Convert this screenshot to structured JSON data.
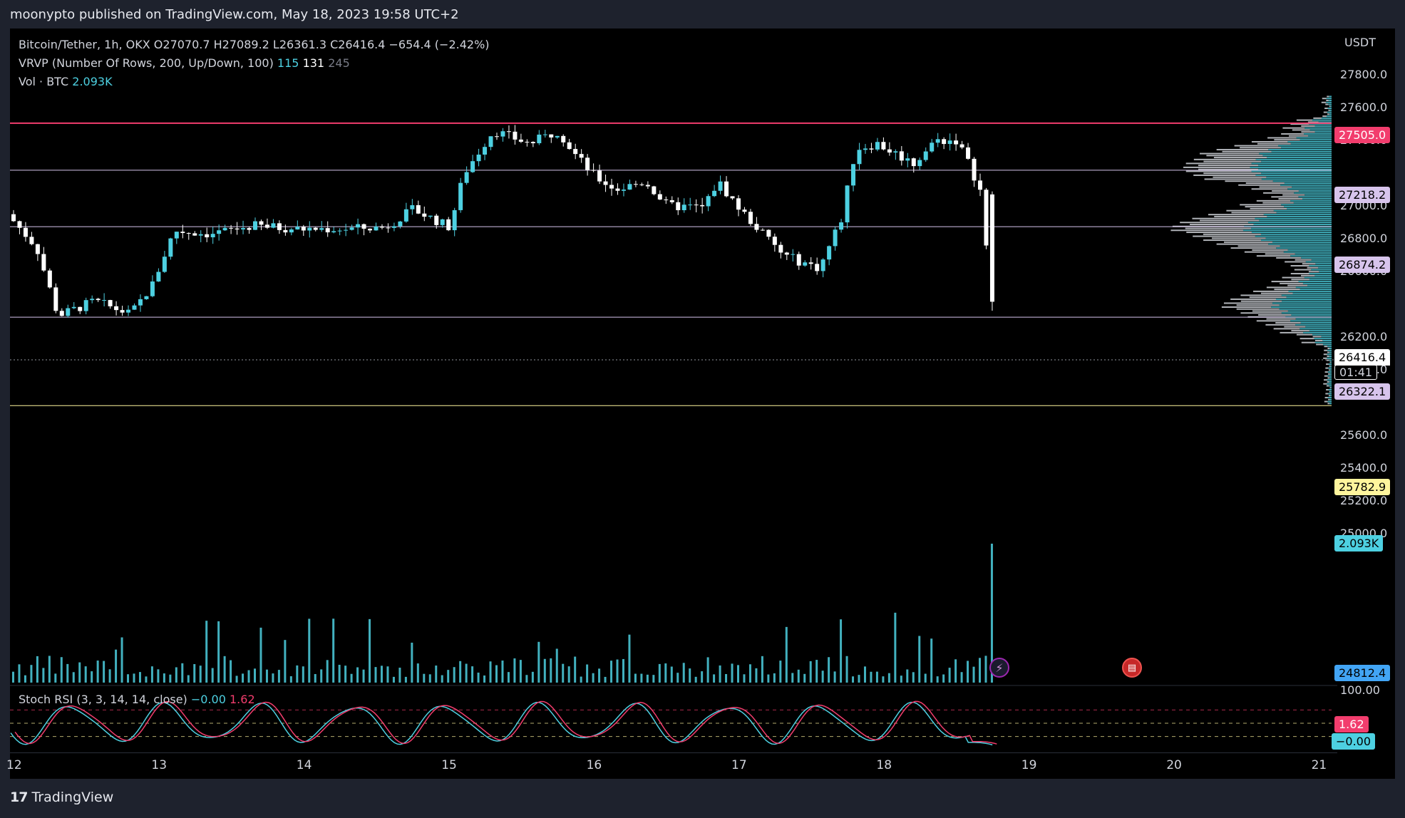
{
  "header": {
    "publish_text": "moonypto published on TradingView.com, May 18, 2023 19:58 UTC+2"
  },
  "legend": {
    "line1": "Bitcoin/Tether, 1h, OKX  O27070.7  H27089.2  L26361.3  C26416.4  −654.4 (−2.42%)",
    "vrvp_label": "VRVP (Number Of Rows, 200, Up/Down, 100)",
    "vrvp_v1": "115",
    "vrvp_v2": "131",
    "vrvp_v3": "245",
    "vol_label": "Vol · BTC",
    "vol_value": "2.093K",
    "stoch_label": "Stoch RSI (3, 3, 14, 14, close)",
    "stoch_k": "−0.00",
    "stoch_d": "1.62"
  },
  "axis": {
    "currency": "USDT",
    "price_ticks": [
      "27800.0",
      "27600.0",
      "27400.0",
      "27000.0",
      "26800.0",
      "26600.0",
      "26200.0",
      "26000.0",
      "25600.0",
      "25400.0",
      "25200.0",
      "25000.0"
    ],
    "price_tag_27505": "27505.0",
    "price_tag_27218": "27218.2",
    "price_tag_26874": "26874.2",
    "price_tag_last": "26416.4",
    "countdown": "01:41",
    "price_tag_26322": "26322.1",
    "price_tag_25782": "25782.9",
    "volume_tag": "2.093K",
    "price_tag_24812": "24812.4",
    "stoch_top": "100.00",
    "stoch_d_tag": "1.62",
    "stoch_k_tag": "−0.00",
    "x_ticks": [
      "12",
      "13",
      "14",
      "15",
      "16",
      "17",
      "18",
      "19",
      "20",
      "21"
    ]
  },
  "footer": {
    "brand": "TradingView"
  },
  "colors": {
    "bg": "#000000",
    "up": "#4dd0e1",
    "down": "#ffffff",
    "resistance": "#f23d6d",
    "level": "#d7c4ec",
    "support": "#fff59d",
    "stoch_k": "#4dd0e1",
    "stoch_d": "#f23d6d"
  },
  "chart_data": {
    "type": "candlestick",
    "symbol": "Bitcoin/Tether",
    "interval": "1h",
    "exchange": "OKX",
    "last_bar": {
      "open": 27070.7,
      "high": 27089.2,
      "low": 26361.3,
      "close": 26416.4,
      "change": -654.4,
      "change_pct": -2.42
    },
    "x_axis": {
      "labels": [
        "12",
        "13",
        "14",
        "15",
        "16",
        "17",
        "18",
        "19",
        "20",
        "21"
      ]
    },
    "y_axis": {
      "range": [
        24700,
        27900
      ],
      "unit": "USDT"
    },
    "horizontal_levels": [
      {
        "price": 27505.0,
        "color": "#f23d6d"
      },
      {
        "price": 27218.2,
        "color": "#d7c4ec"
      },
      {
        "price": 26874.2,
        "color": "#d7c4ec"
      },
      {
        "price": 26322.1,
        "color": "#d7c4ec"
      },
      {
        "price": 25782.9,
        "color": "#fff59d"
      }
    ],
    "close_path_approx": [
      [
        12.0,
        26950
      ],
      [
        12.2,
        26750
      ],
      [
        12.35,
        26330
      ],
      [
        12.6,
        26420
      ],
      [
        12.85,
        26340
      ],
      [
        13.0,
        26520
      ],
      [
        13.15,
        26850
      ],
      [
        13.4,
        26830
      ],
      [
        13.7,
        26880
      ],
      [
        14.0,
        26860
      ],
      [
        14.3,
        26860
      ],
      [
        14.6,
        26870
      ],
      [
        14.8,
        26980
      ],
      [
        15.05,
        26870
      ],
      [
        15.15,
        27200
      ],
      [
        15.35,
        27460
      ],
      [
        15.6,
        27380
      ],
      [
        15.8,
        27460
      ],
      [
        15.9,
        27330
      ],
      [
        16.05,
        27180
      ],
      [
        16.2,
        27100
      ],
      [
        16.4,
        27150
      ],
      [
        16.55,
        27000
      ],
      [
        16.8,
        26990
      ],
      [
        16.9,
        27150
      ],
      [
        17.05,
        26980
      ],
      [
        17.35,
        26700
      ],
      [
        17.6,
        26620
      ],
      [
        17.75,
        26920
      ],
      [
        17.85,
        27350
      ],
      [
        18.0,
        27380
      ],
      [
        18.25,
        27260
      ],
      [
        18.4,
        27400
      ],
      [
        18.55,
        27400
      ],
      [
        18.65,
        27220
      ],
      [
        18.72,
        27070
      ],
      [
        18.78,
        26416.4
      ]
    ],
    "volume_last": "2.093K",
    "stoch_rsi": {
      "params": "3, 3, 14, 14, close",
      "k": -0.0,
      "d": 1.62,
      "levels": [
        80,
        50,
        20
      ]
    }
  }
}
